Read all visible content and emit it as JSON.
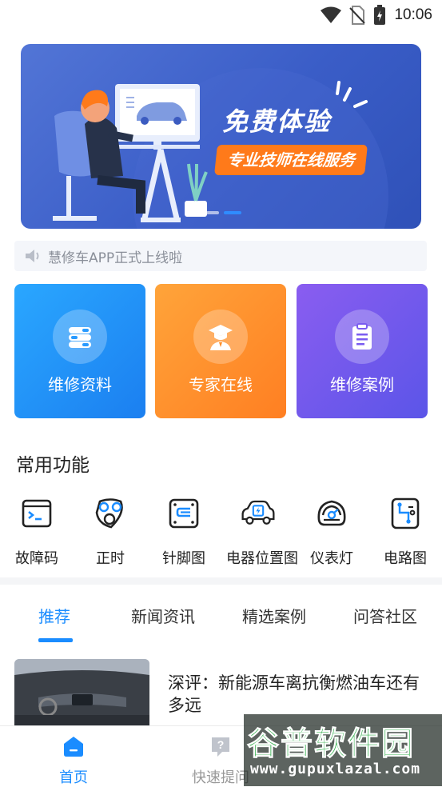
{
  "status_bar": {
    "time": "10:06",
    "icons": [
      "wifi-icon",
      "no-sim-icon",
      "battery-charging-icon"
    ]
  },
  "banner": {
    "title": "免费体验",
    "subtitle": "专业技师在线服务",
    "slide_count": 2,
    "active_slide": 2
  },
  "notice": {
    "icon": "speaker-icon",
    "text": "慧修车APP正式上线啦"
  },
  "cards": [
    {
      "label": "维修资料",
      "icon": "books-icon",
      "color_from": "#2aa7ff",
      "color_to": "#1b7ff0"
    },
    {
      "label": "专家在线",
      "icon": "expert-icon",
      "color_from": "#ffa43a",
      "color_to": "#ff7f22"
    },
    {
      "label": "维修案例",
      "icon": "clipboard-icon",
      "color_from": "#8a5df0",
      "color_to": "#5b55e8"
    }
  ],
  "common_functions": {
    "title": "常用功能",
    "items": [
      {
        "label": "故障码",
        "icon": "terminal-icon"
      },
      {
        "label": "正时",
        "icon": "timing-belt-icon"
      },
      {
        "label": "针脚图",
        "icon": "connector-icon"
      },
      {
        "label": "电器位置图",
        "icon": "electric-car-icon"
      },
      {
        "label": "仪表灯",
        "icon": "dashboard-gauge-icon"
      },
      {
        "label": "电路图",
        "icon": "circuit-icon"
      }
    ]
  },
  "news_tabs": {
    "items": [
      "推荐",
      "新闻资讯",
      "精选案例",
      "问答社区"
    ],
    "active": 0
  },
  "news": [
    {
      "title": "深评：新能源车离抗衡燃油车还有多远"
    }
  ],
  "bottom_nav": {
    "items": [
      {
        "label": "首页",
        "icon": "home-icon",
        "active": true
      },
      {
        "label": "快速提问",
        "icon": "question-icon",
        "active": false
      }
    ]
  },
  "watermark": {
    "title": "谷普软件园",
    "url": "www.gupuxlazal.com"
  },
  "colors": {
    "accent": "#1a8cff",
    "banner_bg": "#3a5dc7",
    "banner_tag": "#ff7a1a"
  }
}
